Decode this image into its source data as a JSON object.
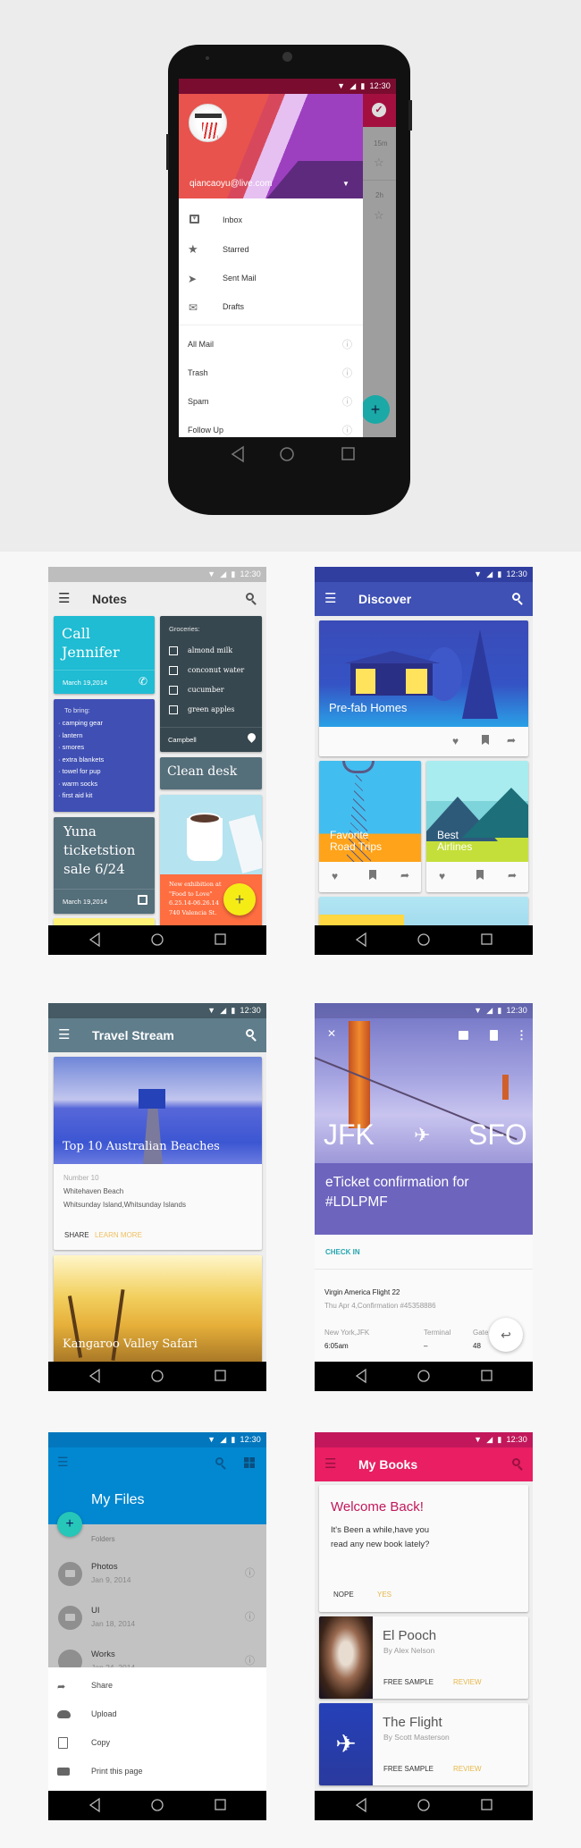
{
  "status_time": "12:30",
  "colors": {
    "notes_cyan": "#1fbcd3",
    "notes_indigo": "#3f4fb4",
    "discover": "#3f51b5",
    "travel": "#607d8b",
    "eticket": "#6d64be",
    "files": "#0288d1",
    "books": "#e91e63",
    "teal": "#26a69a"
  },
  "mail": {
    "email": "qiancaoyu@live.com",
    "primary_items": [
      {
        "label": "Inbox",
        "icon": "inbox-icon"
      },
      {
        "label": "Starred",
        "icon": "star-icon"
      },
      {
        "label": "Sent Mail",
        "icon": "send-icon"
      },
      {
        "label": "Drafts",
        "icon": "drafts-icon"
      }
    ],
    "secondary_items": [
      "All Mail",
      "Trash",
      "Spam",
      "Follow Up"
    ],
    "background_times": [
      "15m",
      "2h"
    ]
  },
  "notes": {
    "title": "Notes",
    "call": {
      "title_1": "Call",
      "title_2": "Jennifer",
      "date": "March 19,2014"
    },
    "bring": {
      "label": "To bring:",
      "items": [
        "· camping gear",
        "· lantern",
        "· smores",
        "· extra blankets",
        "· towel for pup",
        "· warm socks",
        "· first aid kit"
      ]
    },
    "yuna": {
      "title_1": "Yuna",
      "title_2": "ticketstion",
      "title_3": "sale 6/24",
      "date": "March 19,2014"
    },
    "groceries": {
      "label": "Groceries:",
      "items": [
        "almond milk",
        "conconut water",
        "cucumber",
        "green apples"
      ],
      "location": "Campbell"
    },
    "clean": "Clean desk",
    "exhibition": [
      "New exhibition at",
      "\"Food to Love\"",
      "6.25.14-06.26.14",
      "740 Valencia St."
    ]
  },
  "discover": {
    "title": "Discover",
    "cards": [
      "Pre-fab Homes",
      "Favorite",
      "Road Trips",
      "Best",
      "Airlines"
    ]
  },
  "travel": {
    "title": "Travel Stream",
    "card1": {
      "title": "Top 10 Australian Beaches",
      "number": "Number 10",
      "name": "Whitehaven Beach",
      "location": "Whitsunday Island,Whitsunday Islands",
      "share": "SHARE",
      "learn": "LEARN MORE"
    },
    "card2": {
      "title": "Kangaroo Valley Safari"
    }
  },
  "ticket": {
    "from": "JFK",
    "to": "SFO",
    "title_1": "eTicket confirmation for",
    "title_2": "#LDLPMF",
    "checkin": "CHECK IN",
    "flight": "Virgin America Flight 22",
    "date": "Thu Apr 4,Confirmation #45358886",
    "origin_label": "New York,JFK",
    "origin_time": "6:05am",
    "terminal_label": "Terminal",
    "terminal_value": "–",
    "gate_label": "Gate",
    "gate_value": "48"
  },
  "files": {
    "title": "My Files",
    "folders_label": "Folders",
    "folders": [
      {
        "name": "Photos",
        "date": "Jan 9, 2014"
      },
      {
        "name": "UI",
        "date": "Jan 18, 2014"
      },
      {
        "name": "Works",
        "date": "Jan 24, 2014"
      }
    ],
    "sheet": [
      {
        "label": "Share",
        "icon": "share-icon"
      },
      {
        "label": "Upload",
        "icon": "upload-icon"
      },
      {
        "label": "Copy",
        "icon": "copy-icon"
      },
      {
        "label": "Print this page",
        "icon": "print-icon"
      }
    ]
  },
  "books": {
    "title": "My Books",
    "welcome": {
      "title": "Welcome Back!",
      "line_1": "It's Been a while,have you",
      "line_2": "read any new book lately?",
      "nope": "NOPE",
      "yes": "YES"
    },
    "items": [
      {
        "title": "El Pooch",
        "author": "By Alex Nelson",
        "sample": "FREE SAMPLE",
        "review": "REVIEW"
      },
      {
        "title": "The Flight",
        "author": "By Scott Masterson",
        "sample": "FREE SAMPLE",
        "review": "REVIEW"
      }
    ]
  }
}
